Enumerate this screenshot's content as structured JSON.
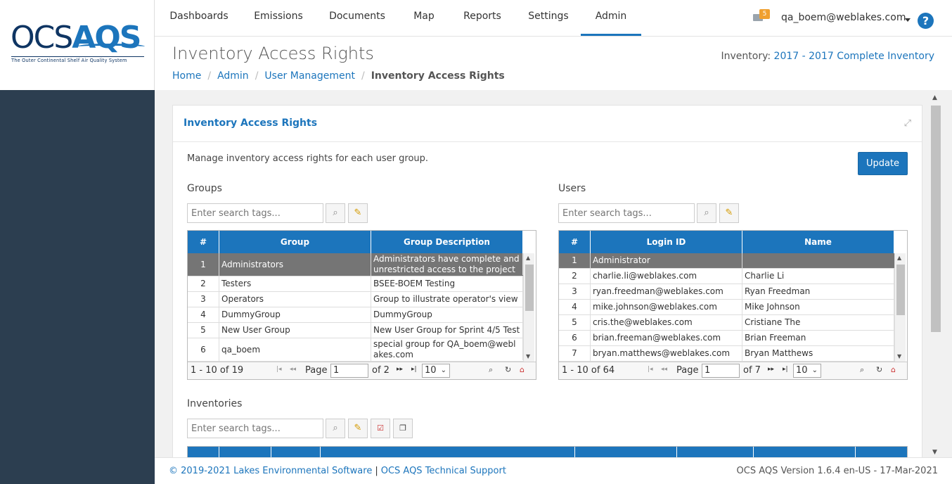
{
  "brand": {
    "part1": "OCS",
    "part2": "AQS",
    "tagline": "The Outer Continental Shelf Air Quality System"
  },
  "nav": {
    "items": [
      "Dashboards",
      "Emissions",
      "Documents",
      "Map",
      "Reports",
      "Settings",
      "Admin"
    ],
    "active": "Admin",
    "mail_count": "5",
    "user": "qa_boem@weblakes.com",
    "help": "?"
  },
  "header": {
    "title": "Inventory Access Rights",
    "inventory_label": "Inventory:",
    "inventory_value": "2017 - 2017 Complete Inventory",
    "breadcrumb": [
      "Home",
      "Admin",
      "User Management",
      "Inventory Access Rights"
    ]
  },
  "panel": {
    "title": "Inventory Access Rights",
    "description": "Manage inventory access rights for each user group.",
    "update_label": "Update"
  },
  "groups": {
    "title": "Groups",
    "search_placeholder": "Enter search tags...",
    "columns": [
      "#",
      "Group",
      "Group Description"
    ],
    "rows": [
      [
        "1",
        "Administrators",
        "Administrators have complete and unrestricted access to the project"
      ],
      [
        "2",
        "Testers",
        "BSEE-BOEM Testing"
      ],
      [
        "3",
        "Operators",
        "Group to illustrate operator's view"
      ],
      [
        "4",
        "DummyGroup",
        "DummyGroup"
      ],
      [
        "5",
        "New User Group",
        "New User Group for Sprint 4/5 Test"
      ],
      [
        "6",
        "qa_boem",
        "special group for QA_boem@weblakes.com"
      ]
    ],
    "pager": {
      "range": "1 - 10 of 19",
      "page_label": "Page",
      "page": "1",
      "of": "of 2",
      "size": "10"
    }
  },
  "users": {
    "title": "Users",
    "search_placeholder": "Enter search tags...",
    "columns": [
      "#",
      "Login ID",
      "Name"
    ],
    "rows": [
      [
        "1",
        "Administrator",
        ""
      ],
      [
        "2",
        "charlie.li@weblakes.com",
        "Charlie Li"
      ],
      [
        "3",
        "ryan.freedman@weblakes.com",
        "Ryan Freedman"
      ],
      [
        "4",
        "mike.johnson@weblakes.com",
        "Mike Johnson"
      ],
      [
        "5",
        "cris.the@weblakes.com",
        "Cristiane The"
      ],
      [
        "6",
        "brian.freeman@weblakes.com",
        "Brian Freeman"
      ],
      [
        "7",
        "bryan.matthews@weblakes.com",
        "Bryan Matthews"
      ]
    ],
    "pager": {
      "range": "1 - 10 of 64",
      "page_label": "Page",
      "page": "1",
      "of": "of 7",
      "size": "10"
    }
  },
  "inventories": {
    "title": "Inventories",
    "search_placeholder": "Enter search tags..."
  },
  "footer": {
    "copyright": "© 2019-2021 Lakes Environmental Software",
    "separator": "|",
    "support": "OCS AQS Technical Support",
    "version": "OCS AQS Version 1.6.4 en-US - 17-Mar-2021"
  },
  "colors": {
    "accent": "#1c75bc",
    "sidebar": "#2c3e50",
    "selected_row": "#757575",
    "badge": "#f0a030"
  }
}
